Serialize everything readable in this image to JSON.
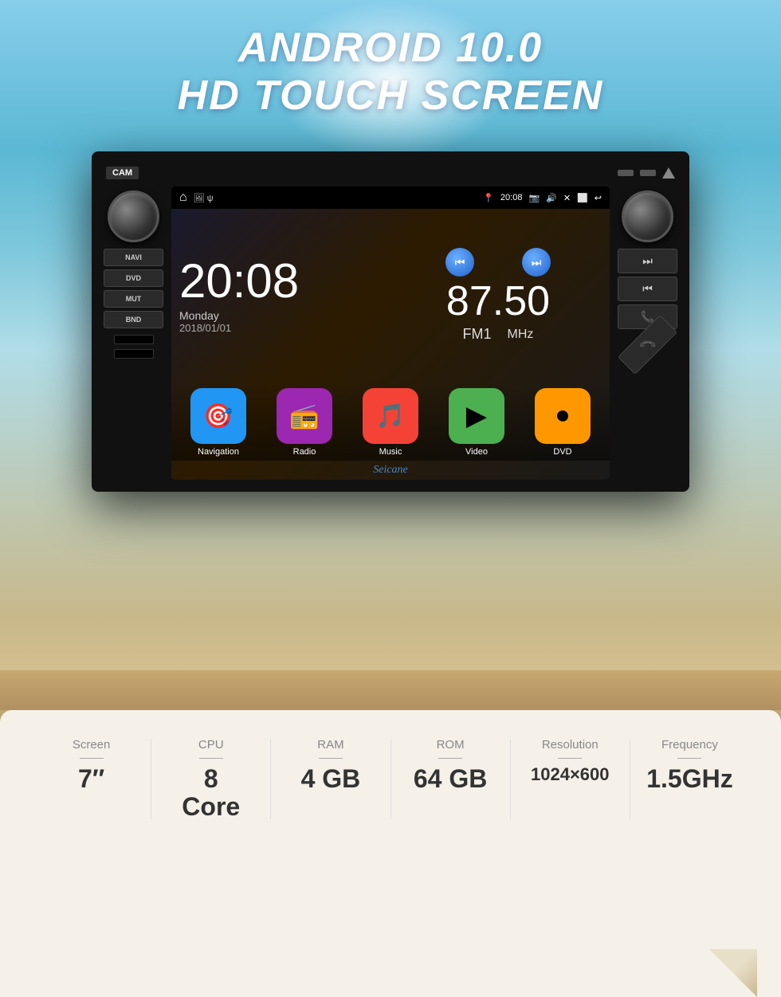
{
  "header": {
    "line1": "ANDROID 10.0",
    "line2": "HD TOUCH SCREEN"
  },
  "statusBar": {
    "time": "20:08",
    "home": "⌂",
    "icons_left": "🖼 ψ",
    "location": "📍",
    "camera": "📷",
    "volume": "🔊",
    "close": "✕",
    "window": "⬜",
    "back": "↩"
  },
  "clock": {
    "time": "20:08",
    "day": "Monday",
    "date": "2018/01/01"
  },
  "radio": {
    "frequency": "87.50",
    "band": "FM1",
    "unit": "MHz"
  },
  "apps": [
    {
      "label": "Navigation",
      "icon": "🎯",
      "class": "nav-icon"
    },
    {
      "label": "Radio",
      "icon": "📻",
      "class": "radio-icon"
    },
    {
      "label": "Music",
      "icon": "🎵",
      "class": "music-icon"
    },
    {
      "label": "Video",
      "icon": "▶",
      "class": "video-icon"
    },
    {
      "label": "DVD",
      "icon": "⏺",
      "class": "dvd-icon"
    }
  ],
  "watermark": "Seicane",
  "sideButtons": {
    "left": [
      "NAVI",
      "DVD",
      "MUT",
      "BND"
    ],
    "right": [
      "⏭",
      "⏮",
      "📞",
      "📞"
    ]
  },
  "specs": [
    {
      "label": "Screen",
      "value": "7″"
    },
    {
      "label": "CPU",
      "value": "8\nCore"
    },
    {
      "label": "RAM",
      "value": "4 GB"
    },
    {
      "label": "ROM",
      "value": "64 GB"
    },
    {
      "label": "Resolution",
      "value": "1024×600"
    },
    {
      "label": "Frequency",
      "value": "1.5GHz"
    }
  ]
}
